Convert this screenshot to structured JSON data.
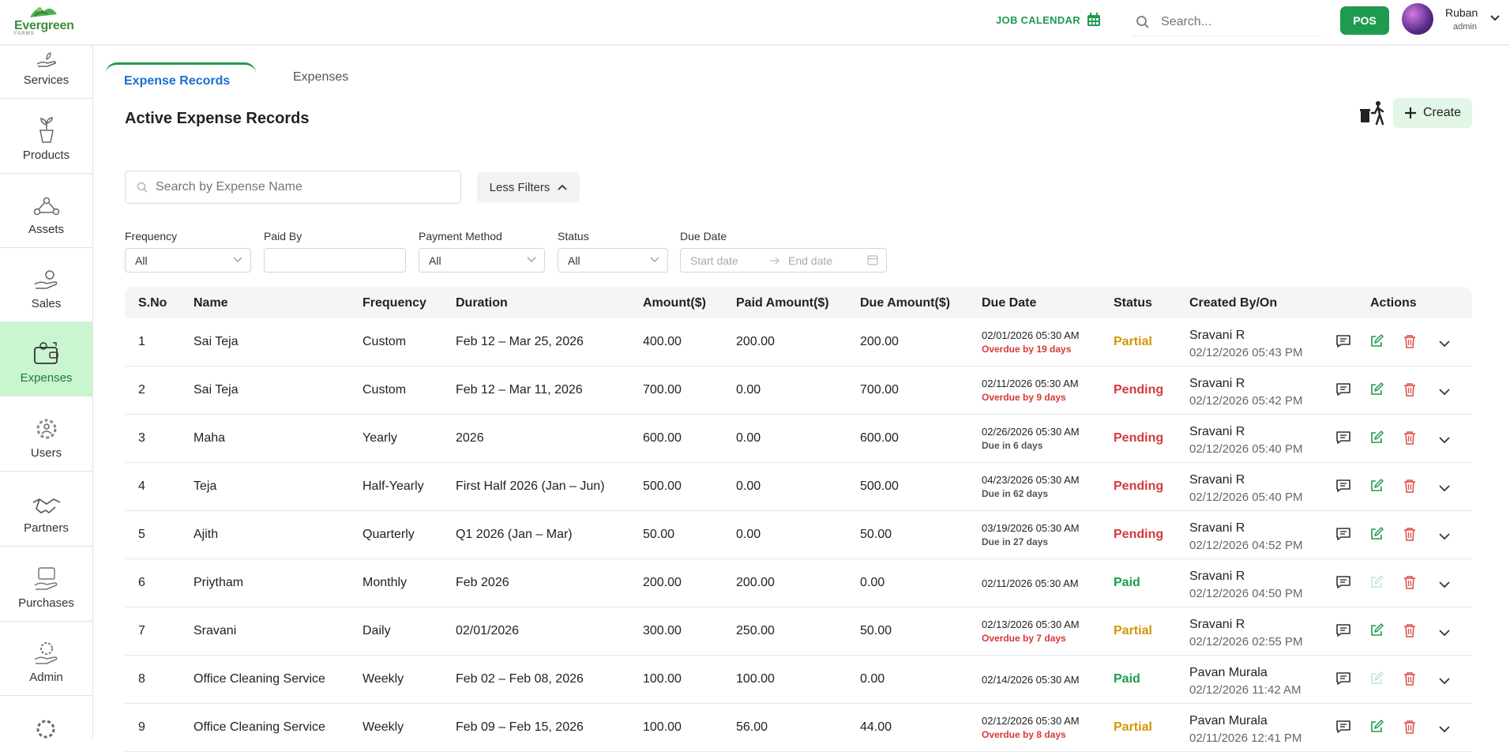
{
  "app": {
    "logo_text": "Evergreen",
    "logo_sub": "FARMS",
    "job_calendar": "JOB CALENDAR",
    "search_placeholder": "Search...",
    "pos": "POS",
    "user_name": "Ruban",
    "user_role": "admin"
  },
  "sidebar": {
    "items": [
      {
        "label": "Services",
        "icon": "hand-plant-icon"
      },
      {
        "label": "Products",
        "icon": "potted-plant-icon"
      },
      {
        "label": "Assets",
        "icon": "network-icon"
      },
      {
        "label": "Sales",
        "icon": "hand-coins-icon"
      },
      {
        "label": "Expenses",
        "icon": "wallet-icon"
      },
      {
        "label": "Users",
        "icon": "users-gear-icon"
      },
      {
        "label": "Partners",
        "icon": "handshake-icon"
      },
      {
        "label": "Purchases",
        "icon": "purchase-icon"
      },
      {
        "label": "Admin",
        "icon": "admin-icon"
      }
    ],
    "active": "Expenses"
  },
  "tabs": {
    "active": "Expense Records",
    "other": "Expenses"
  },
  "page": {
    "title": "Active Expense Records",
    "create": "Create",
    "search_placeholder": "Search by Expense Name",
    "less_filters": "Less Filters"
  },
  "filters": {
    "frequency_label": "Frequency",
    "frequency_value": "All",
    "paid_by_label": "Paid By",
    "paid_by_value": "",
    "payment_method_label": "Payment Method",
    "payment_method_value": "All",
    "status_label": "Status",
    "status_value": "All",
    "due_date_label": "Due Date",
    "start_placeholder": "Start date",
    "end_placeholder": "End date"
  },
  "table": {
    "headers": [
      "S.No",
      "Name",
      "Frequency",
      "Duration",
      "Amount($)",
      "Paid Amount($)",
      "Due Amount($)",
      "Due Date",
      "Status",
      "Created By/On",
      "Actions"
    ],
    "rows": [
      {
        "sno": "1",
        "name": "Sai Teja",
        "freq": "Custom",
        "duration": "Feb 12 – Mar 25, 2026",
        "amount": "400.00",
        "paid": "200.00",
        "due": "200.00",
        "due_date": "02/01/2026 05:30 AM",
        "due_note": "Overdue by 19 days",
        "note_type": "overdue",
        "status": "Partial",
        "by": "Sravani R",
        "on": "02/12/2026 05:43 PM",
        "edit_enabled": true
      },
      {
        "sno": "2",
        "name": "Sai Teja",
        "freq": "Custom",
        "duration": "Feb 12 – Mar 11, 2026",
        "amount": "700.00",
        "paid": "0.00",
        "due": "700.00",
        "due_date": "02/11/2026 05:30 AM",
        "due_note": "Overdue by 9 days",
        "note_type": "overdue",
        "status": "Pending",
        "by": "Sravani R",
        "on": "02/12/2026 05:42 PM",
        "edit_enabled": true
      },
      {
        "sno": "3",
        "name": "Maha",
        "freq": "Yearly",
        "duration": "2026",
        "amount": "600.00",
        "paid": "0.00",
        "due": "600.00",
        "due_date": "02/26/2026 05:30 AM",
        "due_note": "Due in 6 days",
        "note_type": "due",
        "status": "Pending",
        "by": "Sravani R",
        "on": "02/12/2026 05:40 PM",
        "edit_enabled": true
      },
      {
        "sno": "4",
        "name": "Teja",
        "freq": "Half-Yearly",
        "duration": "First Half 2026 (Jan – Jun)",
        "amount": "500.00",
        "paid": "0.00",
        "due": "500.00",
        "due_date": "04/23/2026 05:30 AM",
        "due_note": "Due in 62 days",
        "note_type": "due",
        "status": "Pending",
        "by": "Sravani R",
        "on": "02/12/2026 05:40 PM",
        "edit_enabled": true
      },
      {
        "sno": "5",
        "name": "Ajith",
        "freq": "Quarterly",
        "duration": "Q1 2026 (Jan – Mar)",
        "amount": "50.00",
        "paid": "0.00",
        "due": "50.00",
        "due_date": "03/19/2026 05:30 AM",
        "due_note": "Due in 27 days",
        "note_type": "due",
        "status": "Pending",
        "by": "Sravani R",
        "on": "02/12/2026 04:52 PM",
        "edit_enabled": true
      },
      {
        "sno": "6",
        "name": "Priytham",
        "freq": "Monthly",
        "duration": "Feb 2026",
        "amount": "200.00",
        "paid": "200.00",
        "due": "0.00",
        "due_date": "02/11/2026 05:30 AM",
        "due_note": "",
        "note_type": "none",
        "status": "Paid",
        "by": "Sravani R",
        "on": "02/12/2026 04:50 PM",
        "edit_enabled": false
      },
      {
        "sno": "7",
        "name": "Sravani",
        "freq": "Daily",
        "duration": "02/01/2026",
        "amount": "300.00",
        "paid": "250.00",
        "due": "50.00",
        "due_date": "02/13/2026 05:30 AM",
        "due_note": "Overdue by 7 days",
        "note_type": "overdue",
        "status": "Partial",
        "by": "Sravani R",
        "on": "02/12/2026 02:55 PM",
        "edit_enabled": true
      },
      {
        "sno": "8",
        "name": "Office Cleaning Service",
        "freq": "Weekly",
        "duration": "Feb 02 – Feb 08, 2026",
        "amount": "100.00",
        "paid": "100.00",
        "due": "0.00",
        "due_date": "02/14/2026 05:30 AM",
        "due_note": "",
        "note_type": "none",
        "status": "Paid",
        "by": "Pavan Murala",
        "on": "02/12/2026 11:42 AM",
        "edit_enabled": false
      },
      {
        "sno": "9",
        "name": "Office Cleaning Service",
        "freq": "Weekly",
        "duration": "Feb 09 – Feb 15, 2026",
        "amount": "100.00",
        "paid": "56.00",
        "due": "44.00",
        "due_date": "02/12/2026 05:30 AM",
        "due_note": "Overdue by 8 days",
        "note_type": "overdue",
        "status": "Partial",
        "by": "Pavan Murala",
        "on": "02/11/2026 12:41 PM",
        "edit_enabled": true
      }
    ]
  },
  "colors": {
    "brand_green": "#1f9b4f",
    "tab_blue": "#1a6fd0",
    "partial": "#d4950b",
    "pending": "#d63a3a",
    "paid": "#1f9b4f",
    "overdue": "#d63a3a",
    "due": "#555555"
  }
}
